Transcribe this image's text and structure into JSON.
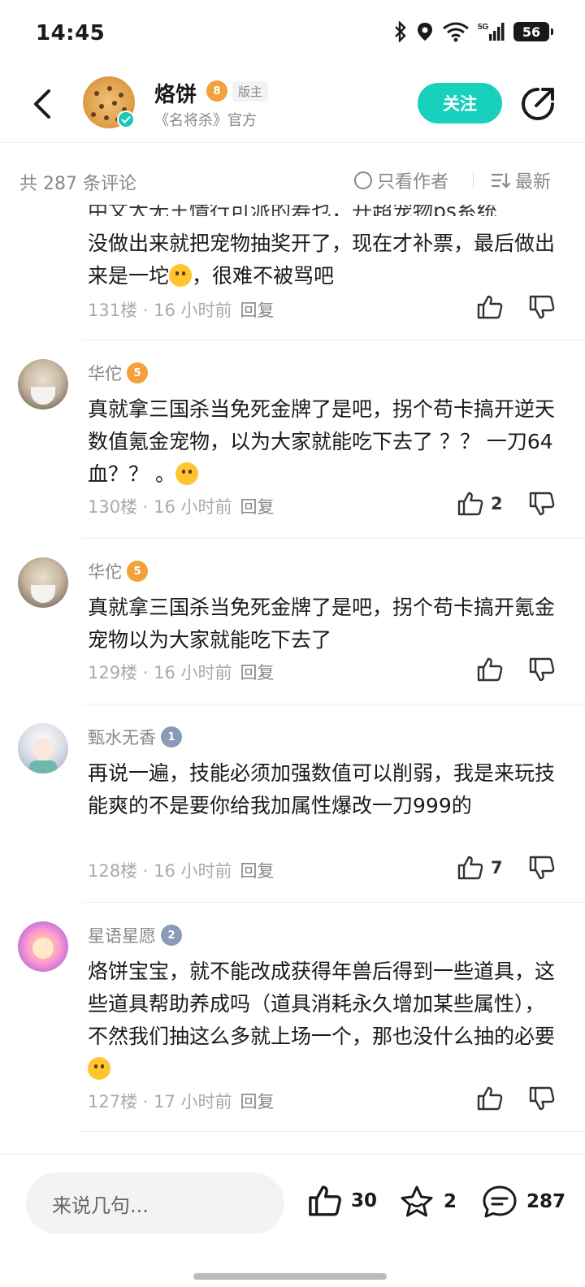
{
  "status_bar": {
    "time": "14:45",
    "battery": "56",
    "network": "5G"
  },
  "header": {
    "name": "烙饼",
    "level": "8",
    "badge": "版主",
    "subtitle": "《名将杀》官方",
    "follow_label": "关注"
  },
  "filter": {
    "count_label": "共 287 条评论",
    "only_author": "只看作者",
    "sort": "最新"
  },
  "comments": [
    {
      "text_partial_line": "中文大无王情行可派的寿乜，开超宠物ps系统",
      "text": "没做出来就把宠物抽奖开了，现在才补票，最后做出来是一坨",
      "text_suffix": "，很难不被骂吧",
      "floor": "131楼",
      "time": "16 小时前",
      "reply": "回复",
      "likes": ""
    },
    {
      "name": "华佗",
      "level": "5",
      "text": "真就拿三国杀当免死金牌了是吧，拐个苟卡搞开逆天数值氪金宠物，以为大家就能吃下去了 ？？ 一刀64血？？ 。",
      "floor": "130楼",
      "time": "16 小时前",
      "reply": "回复",
      "likes": "2"
    },
    {
      "name": "华佗",
      "level": "5",
      "text": "真就拿三国杀当免死金牌了是吧，拐个苟卡搞开氪金宠物以为大家就能吃下去了",
      "floor": "129楼",
      "time": "16 小时前",
      "reply": "回复",
      "likes": ""
    },
    {
      "name": "甄水无香",
      "level": "1",
      "text": "再说一遍，技能必须加强数值可以削弱，我是来玩技能爽的不是要你给我加属性爆改一刀999的",
      "floor": "128楼",
      "time": "16 小时前",
      "reply": "回复",
      "likes": "7"
    },
    {
      "name": "星语星愿",
      "level": "2",
      "text": "烙饼宝宝，就不能改成获得年兽后得到一些道具，这些道具帮助养成吗（道具消耗永久增加某些属性），不然我们抽这么多就上场一个，那也没什么抽的必要",
      "floor": "127楼",
      "time": "17 小时前",
      "reply": "回复",
      "likes": ""
    }
  ],
  "bottom_bar": {
    "input_placeholder": "来说几句...",
    "likes": "30",
    "favorites": "2",
    "comments": "287"
  },
  "colors": {
    "accent": "#17d1bc",
    "gold_level": "#f3a13a",
    "gray_level": "#8a9bb8"
  }
}
